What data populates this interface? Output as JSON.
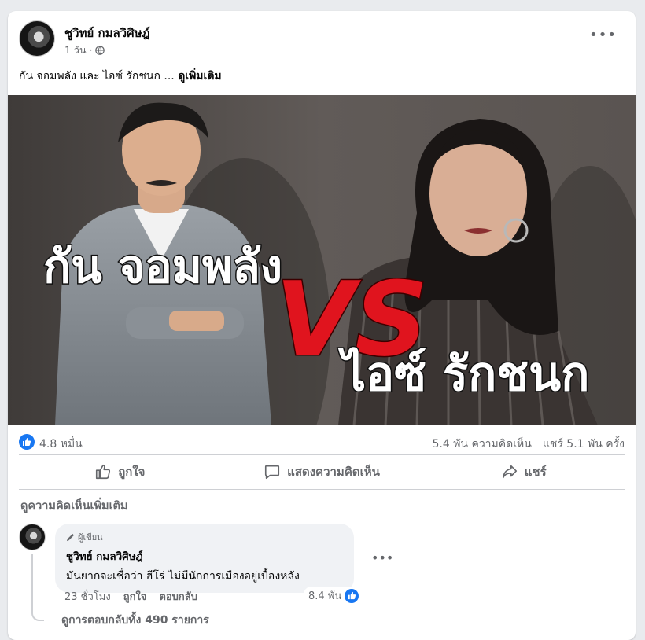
{
  "post": {
    "author": "ชูวิทย์ กมลวิศิษฎ์",
    "time": "1 วัน ·",
    "caption": "กัน จอมพลัง และ ไอซ์ รักชนก ...",
    "see_more": "ดูเพิ่มเติม",
    "image_text": {
      "left_name": "กัน จอมพลัง",
      "vs": "VS",
      "right_name": "ไอซ์ รักชนก"
    }
  },
  "stats": {
    "reactions": "4.8 หมื่น",
    "comments": "5.4 พัน ความคิดเห็น",
    "shares": "แชร์ 5.1 พัน ครั้ง"
  },
  "actions": {
    "like": "ถูกใจ",
    "comment": "แสดงความคิดเห็น",
    "share": "แชร์"
  },
  "view_more_comments": "ดูความคิดเห็นเพิ่มเติม",
  "comment": {
    "badge": "ผู้เขียน",
    "author": "ชูวิทย์ กมลวิศิษฎ์",
    "text": "มันยากจะเชื่อว่า ฮีโร่ ไม่มีนักการเมืองอยู่เบื้องหลัง",
    "time": "23 ชั่วโมง",
    "like": "ถูกใจ",
    "reply": "ตอบกลับ",
    "reactions": "8.4 พัน",
    "replies": "ดูการตอบกลับทั้ง 490 รายการ"
  },
  "colors": {
    "accent": "#1877f2",
    "vs_red": "#e0141e",
    "muted_text": "#65676b"
  },
  "icons": [
    "globe-icon",
    "more-icon",
    "like-icon",
    "comment-icon",
    "share-icon",
    "pencil-icon"
  ]
}
